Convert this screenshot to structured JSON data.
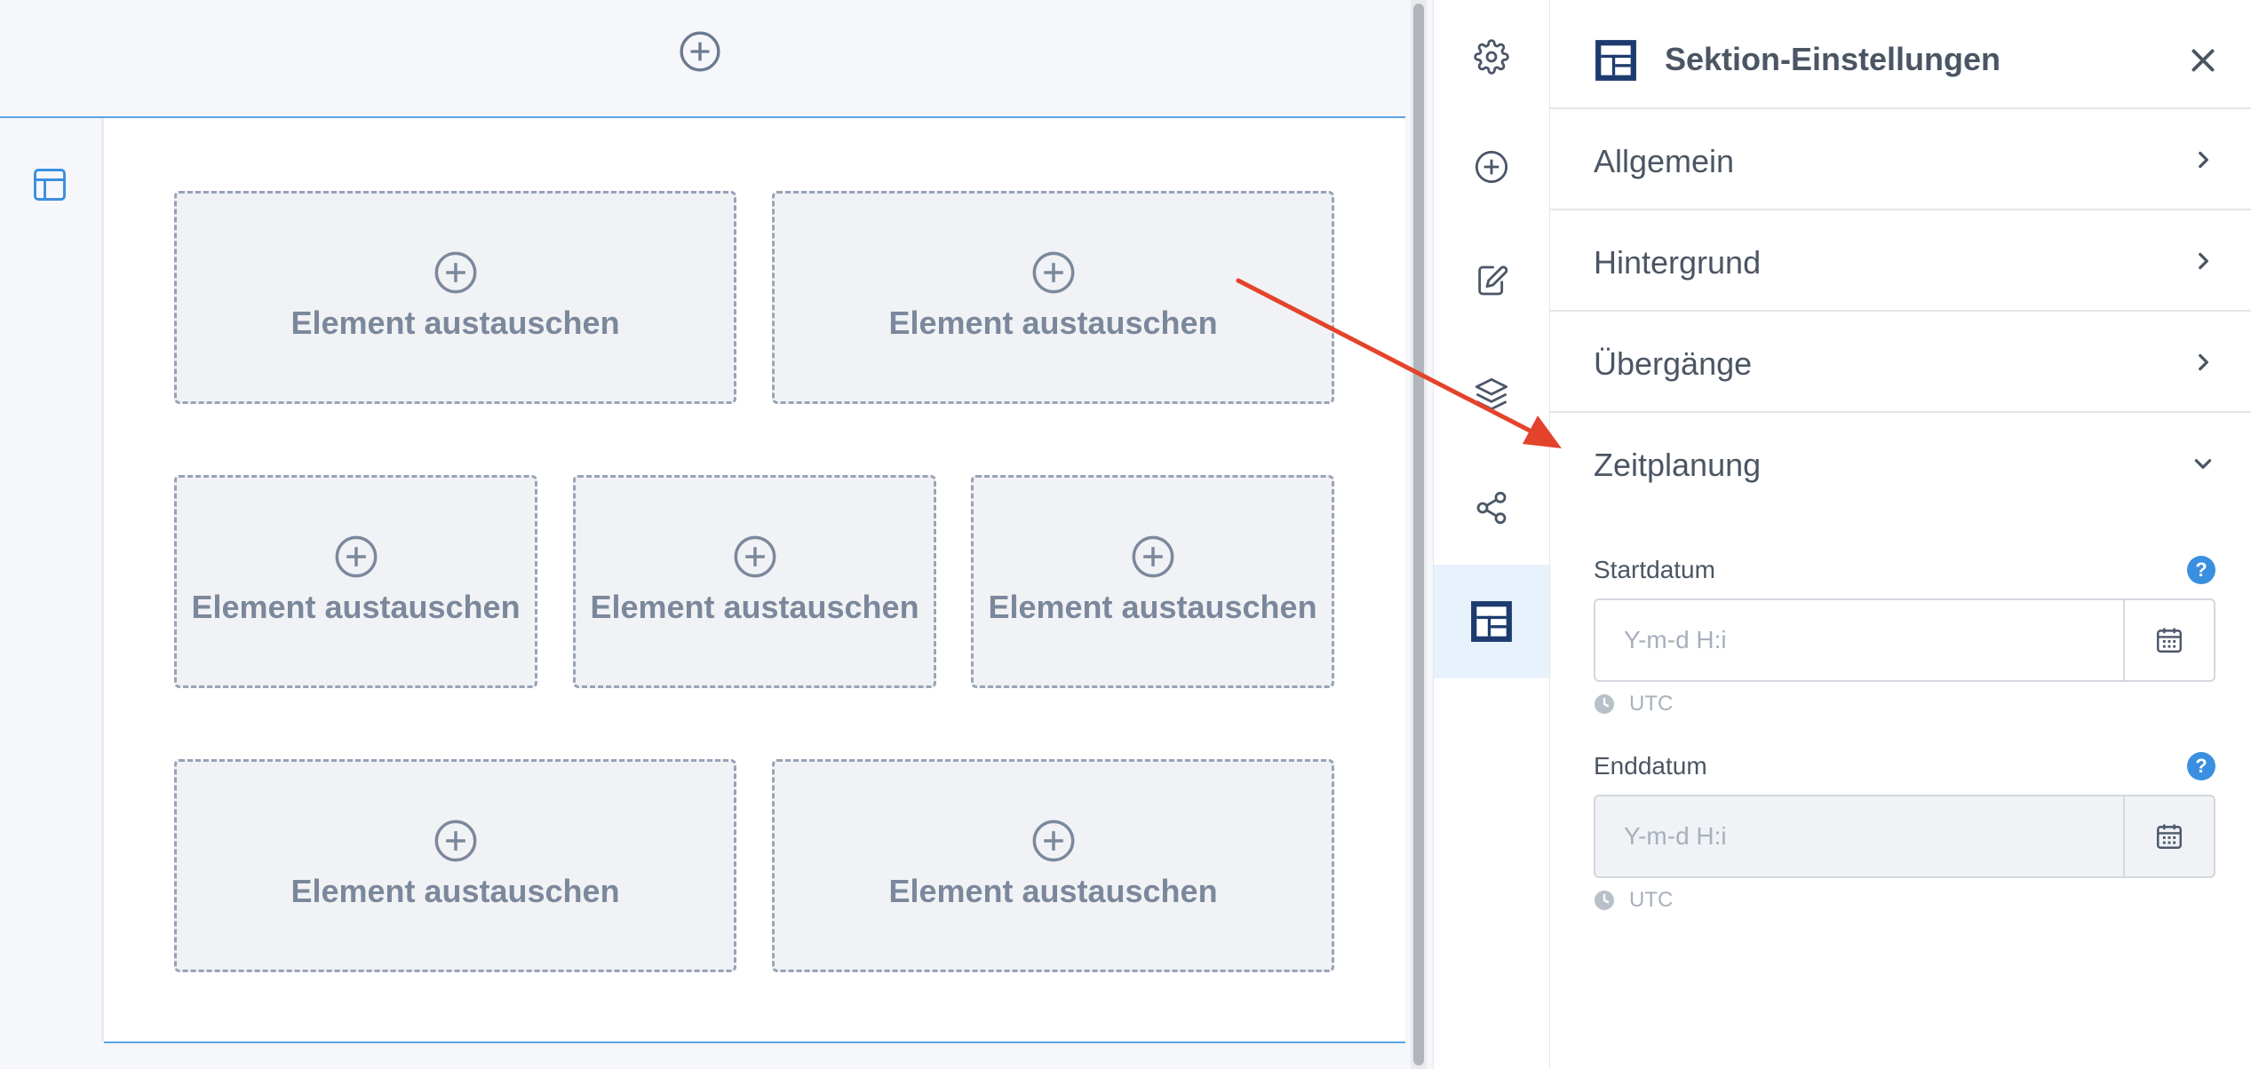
{
  "canvas": {
    "slots": [
      {
        "label": "Element austauschen"
      },
      {
        "label": "Element austauschen"
      },
      {
        "label": "Element austauschen"
      },
      {
        "label": "Element austauschen"
      },
      {
        "label": "Element austauschen"
      },
      {
        "label": "Element austauschen"
      },
      {
        "label": "Element austauschen"
      }
    ]
  },
  "rail": {
    "items": [
      {
        "icon": "gear-icon"
      },
      {
        "icon": "plus-circle-icon"
      },
      {
        "icon": "edit-icon"
      },
      {
        "icon": "layers-icon"
      },
      {
        "icon": "share-icon"
      },
      {
        "icon": "section-layout-icon",
        "active": true
      }
    ]
  },
  "panel": {
    "title": "Sektion-Einstellungen",
    "accordion": [
      {
        "label": "Allgemein",
        "state": "collapsed"
      },
      {
        "label": "Hintergrund",
        "state": "collapsed"
      },
      {
        "label": "Übergänge",
        "state": "collapsed"
      },
      {
        "label": "Zeitplanung",
        "state": "expanded"
      }
    ],
    "scheduling": {
      "start": {
        "label": "Startdatum",
        "placeholder": "Y-m-d H:i",
        "value": "",
        "timezone": "UTC",
        "help": "?"
      },
      "end": {
        "label": "Enddatum",
        "placeholder": "Y-m-d H:i",
        "value": "",
        "timezone": "UTC",
        "help": "?",
        "disabled": true
      }
    }
  },
  "colors": {
    "accent": "#3b8fe0",
    "annotation_arrow": "#e4432b",
    "slot_text": "#7b889c"
  }
}
